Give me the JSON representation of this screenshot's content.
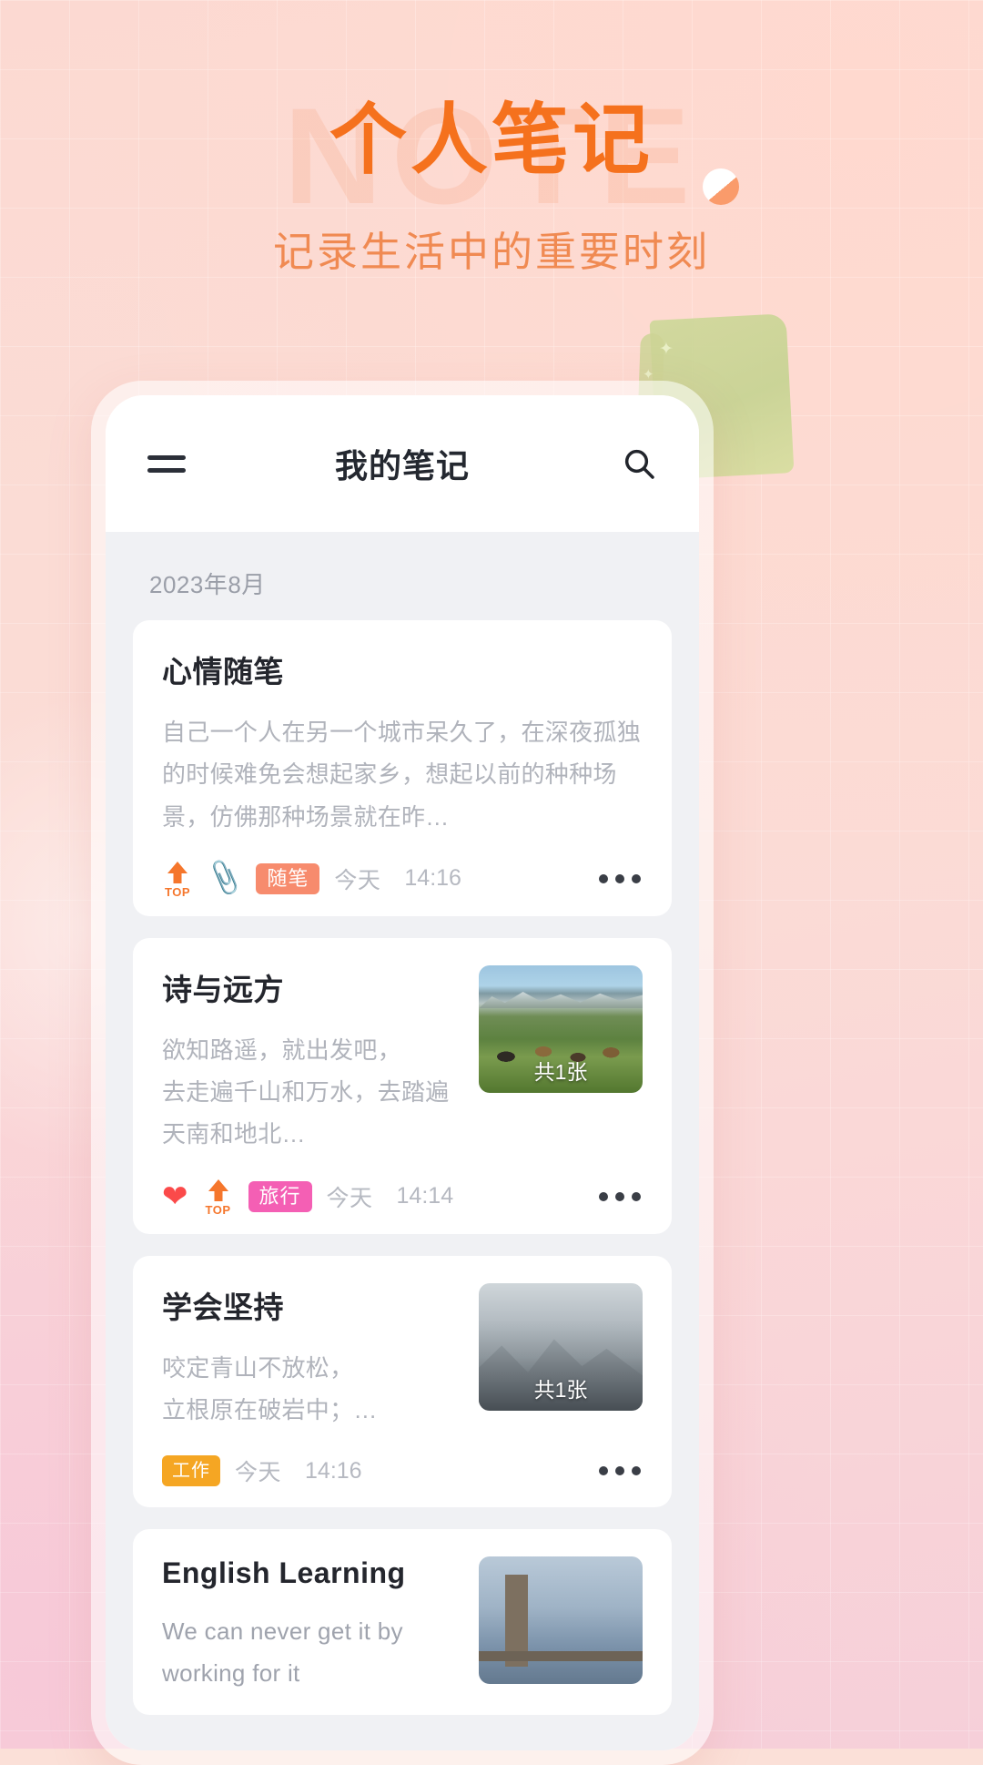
{
  "promo": {
    "watermark": "NOTE",
    "title": "个人笔记",
    "subtitle": "记录生活中的重要时刻",
    "accent_color": "#f5711d",
    "subtitle_color": "#f08a52"
  },
  "app": {
    "menu_icon": "hamburger-menu-icon",
    "title": "我的笔记",
    "search_icon": "search-icon",
    "month_header": "2023年8月",
    "more_icon": "more-dots-icon"
  },
  "notes": [
    {
      "title": "心情随笔",
      "body": "自己一个人在另一个城市呆久了，在深夜孤独的时候难免会想起家乡，想起以前的种种场景，仿佛那种场景就在昨…",
      "pinned": true,
      "pin_label": "TOP",
      "attachment": true,
      "favorite": false,
      "tag": "随笔",
      "tag_color": "#f78b6d",
      "date": "今天",
      "time": "14:16",
      "thumb": null,
      "thumb_count": null
    },
    {
      "title": "诗与远方",
      "body_lines": [
        "欲知路遥，就出发吧，",
        "去走遍千山和万水，去踏遍天南和地北…"
      ],
      "pinned": true,
      "pin_label": "TOP",
      "attachment": false,
      "favorite": true,
      "tag": "旅行",
      "tag_color": "#f45fb4",
      "date": "今天",
      "time": "14:14",
      "thumb": "pasture-mountain-photo",
      "thumb_count": "共1张"
    },
    {
      "title": "学会坚持",
      "body_lines": [
        "咬定青山不放松，",
        "立根原在破岩中；…"
      ],
      "pinned": false,
      "attachment": false,
      "favorite": false,
      "tag": "工作",
      "tag_color": "#f5a623",
      "date": "今天",
      "time": "14:16",
      "thumb": "misty-mountain-photo",
      "thumb_count": "共1张"
    },
    {
      "title": "English Learning",
      "body_lines": [
        "We can never get it by working for it"
      ],
      "pinned": false,
      "attachment": false,
      "favorite": false,
      "tag": null,
      "date": null,
      "time": null,
      "thumb": "tower-bridge-photo",
      "thumb_count": null
    }
  ]
}
